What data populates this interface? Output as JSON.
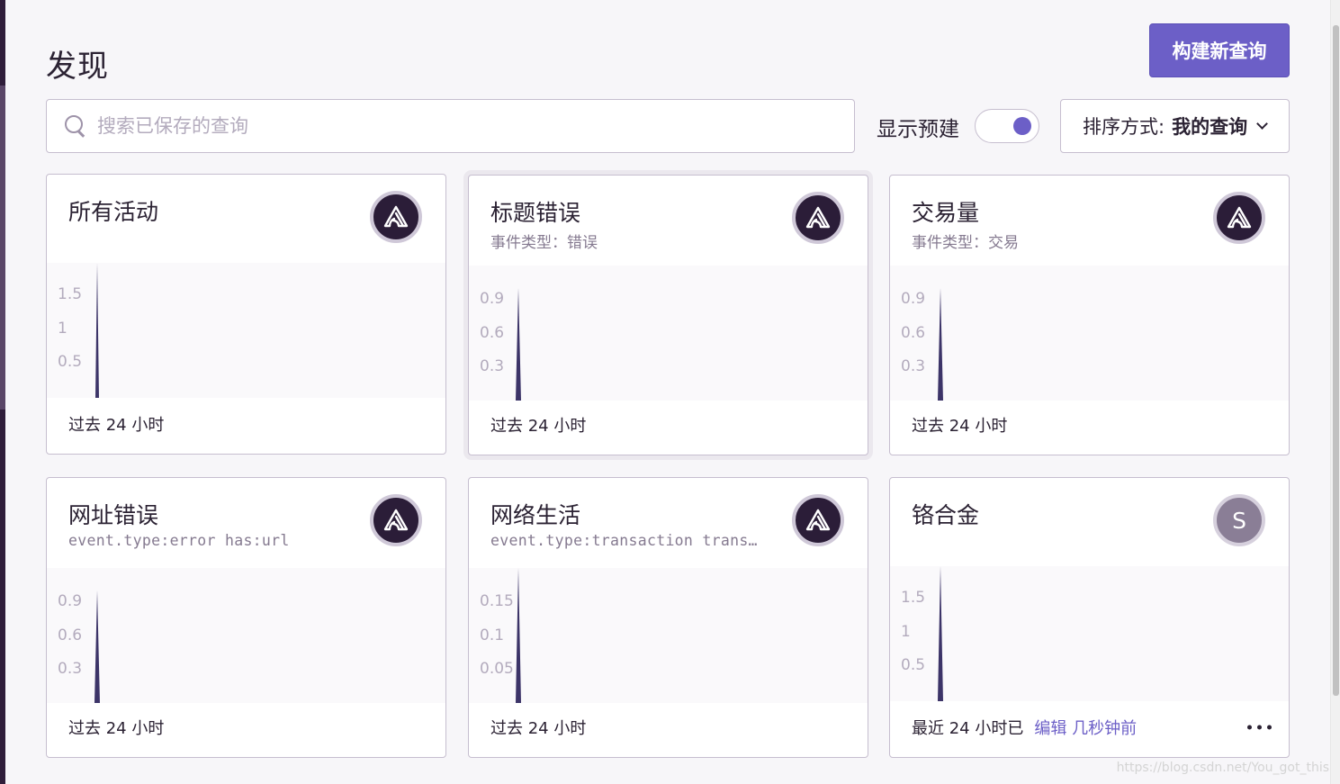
{
  "header": {
    "title": "发现",
    "build_button_label": "构建新查询"
  },
  "search": {
    "placeholder": "搜索已保存的查询",
    "value": ""
  },
  "filters": {
    "show_prebuilt_label": "显示预建",
    "show_prebuilt_on": true,
    "sort_prefix": "排序方式:",
    "sort_value": "我的查询"
  },
  "colors": {
    "accent": "#6c5fc7",
    "bar": "#3c3468",
    "avatar_dark": "#2b1d38",
    "avatar_letter": "#8a7e96"
  },
  "cards": [
    {
      "title": "所有活动",
      "subtitle": "",
      "avatar": "sentry-logo-icon",
      "footer": "过去 24 小时",
      "y_ticks": [
        "1.5",
        "1",
        "0.5"
      ]
    },
    {
      "title": "标题错误",
      "subtitle": "事件类型：错误",
      "avatar": "sentry-logo-icon",
      "footer": "过去 24 小时",
      "y_ticks": [
        "0.9",
        "0.6",
        "0.3"
      ]
    },
    {
      "title": "交易量",
      "subtitle": "事件类型：交易",
      "avatar": "sentry-logo-icon",
      "footer": "过去 24 小时",
      "y_ticks": [
        "0.9",
        "0.6",
        "0.3"
      ]
    },
    {
      "title": "网址错误",
      "subtitle": "event.type:error has:url",
      "avatar": "sentry-logo-icon",
      "footer": "过去 24 小时",
      "y_ticks": [
        "0.9",
        "0.6",
        "0.3"
      ]
    },
    {
      "title": "网络生活",
      "subtitle": "event.type:transaction trans…",
      "avatar": "sentry-logo-icon",
      "footer": "过去 24 小时",
      "y_ticks": [
        "0.15",
        "0.1",
        "0.05"
      ]
    },
    {
      "title": "铬合金",
      "subtitle": "",
      "avatar_letter": "S",
      "footer": "最近 24 小时已",
      "edit_text": "编辑 几秒钟前",
      "y_ticks": [
        "1.5",
        "1",
        "0.5"
      ]
    }
  ],
  "watermark": "https://blog.csdn.net/You_got_this"
}
